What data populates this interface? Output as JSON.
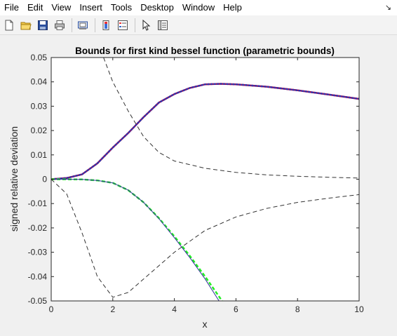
{
  "menu": {
    "items": [
      {
        "label": "File"
      },
      {
        "label": "Edit"
      },
      {
        "label": "View"
      },
      {
        "label": "Insert"
      },
      {
        "label": "Tools"
      },
      {
        "label": "Desktop"
      },
      {
        "label": "Window"
      },
      {
        "label": "Help"
      }
    ],
    "dock_glyph": "↘"
  },
  "toolbar": {
    "buttons": [
      "new-figure-icon",
      "open-file-icon",
      "save-icon",
      "print-icon",
      "print-preview-icon",
      "colorbar-icon",
      "legend-icon",
      "edit-plot-arrow-icon",
      "property-inspector-icon"
    ]
  },
  "chart_data": {
    "type": "line",
    "title": "Bounds for first kind bessel function (parametric bounds)",
    "xlabel": "x",
    "ylabel": "signed relative deviation",
    "xlim": [
      0,
      10
    ],
    "ylim": [
      -0.05,
      0.05
    ],
    "xticks": [
      "0",
      "2",
      "4",
      "6",
      "8",
      "10"
    ],
    "yticks": [
      "-0.05",
      "-0.04",
      "-0.03",
      "-0.02",
      "-0.01",
      "0",
      "0.01",
      "0.02",
      "0.03",
      "0.04",
      "0.05"
    ],
    "grid": false,
    "series": [
      {
        "color": "#cc0033",
        "style": "solid",
        "x": [
          0,
          0.5,
          1,
          1.5,
          2,
          2.5,
          3,
          3.5,
          4,
          4.5,
          5,
          5.5,
          6,
          7,
          8,
          9,
          10
        ],
        "y": [
          0,
          0.0005,
          0.002,
          0.0065,
          0.013,
          0.019,
          0.0255,
          0.0315,
          0.035,
          0.0375,
          0.039,
          0.0392,
          0.039,
          0.038,
          0.0365,
          0.0348,
          0.033
        ]
      },
      {
        "color": "#3333aa",
        "style": "dotted",
        "x": [
          0,
          0.5,
          1,
          1.5,
          2,
          2.5,
          3,
          3.5,
          4,
          4.5,
          5,
          5.5,
          6,
          7,
          8,
          9,
          10
        ],
        "y": [
          0,
          0.0005,
          0.002,
          0.0065,
          0.013,
          0.019,
          0.0255,
          0.0315,
          0.035,
          0.0375,
          0.039,
          0.0392,
          0.039,
          0.038,
          0.0365,
          0.0348,
          0.033
        ]
      },
      {
        "color": "#22ee22",
        "style": "solid",
        "x": [
          0,
          1,
          1.5,
          2,
          2.5,
          3,
          3.5,
          4,
          4.5,
          5,
          5.55
        ],
        "y": [
          0,
          -0.0001,
          -0.0005,
          -0.0015,
          -0.0045,
          -0.0095,
          -0.016,
          -0.0235,
          -0.0315,
          -0.04,
          -0.05
        ]
      },
      {
        "color": "#333399",
        "style": "solid",
        "x": [
          0,
          1,
          1.5,
          2,
          2.5,
          3,
          3.5,
          4,
          4.5,
          5,
          5.45
        ],
        "y": [
          0,
          -0.0001,
          -0.0005,
          -0.0015,
          -0.0045,
          -0.0095,
          -0.0162,
          -0.024,
          -0.0322,
          -0.041,
          -0.05
        ]
      },
      {
        "color": "#333333",
        "style": "dashed",
        "x": [
          1.7,
          2,
          2.5,
          3,
          3.5,
          4,
          5,
          6,
          7,
          8,
          9,
          10
        ],
        "y": [
          0.05,
          0.04,
          0.028,
          0.0175,
          0.011,
          0.0075,
          0.0045,
          0.0028,
          0.0018,
          0.0012,
          0.0008,
          0.0005
        ]
      },
      {
        "color": "#333333",
        "style": "dashed",
        "x": [
          0,
          0.5,
          1,
          1.5,
          2,
          2.5,
          3,
          4,
          5,
          6,
          7,
          8,
          9,
          10
        ],
        "y": [
          0,
          -0.006,
          -0.022,
          -0.04,
          -0.0485,
          -0.0465,
          -0.041,
          -0.03,
          -0.021,
          -0.0155,
          -0.012,
          -0.0095,
          -0.0078,
          -0.0063
        ]
      }
    ]
  }
}
